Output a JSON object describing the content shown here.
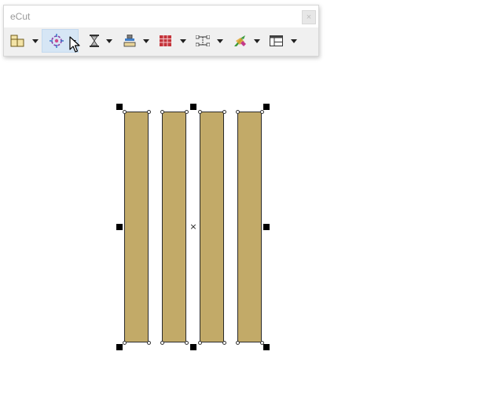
{
  "window": {
    "title": "eCut",
    "close_glyph": "×"
  },
  "toolbar": {
    "tools": [
      {
        "name": "panel-layout-icon",
        "active": false
      },
      {
        "name": "rotate-target-icon",
        "active": true
      },
      {
        "name": "hourglass-icon",
        "active": false
      },
      {
        "name": "machine-clamp-icon",
        "active": false
      },
      {
        "name": "grid-table-icon",
        "active": false
      },
      {
        "name": "dimension-lines-icon",
        "active": false
      },
      {
        "name": "arrow-magic-icon",
        "active": false
      },
      {
        "name": "table-layout-icon",
        "active": false
      }
    ]
  },
  "canvas": {
    "strip_color": "#c2aa68",
    "strip_count": 4,
    "center_marker": "×"
  },
  "colors": {
    "active_tool_bg": "#d6e6f5",
    "handle": "#000000"
  }
}
